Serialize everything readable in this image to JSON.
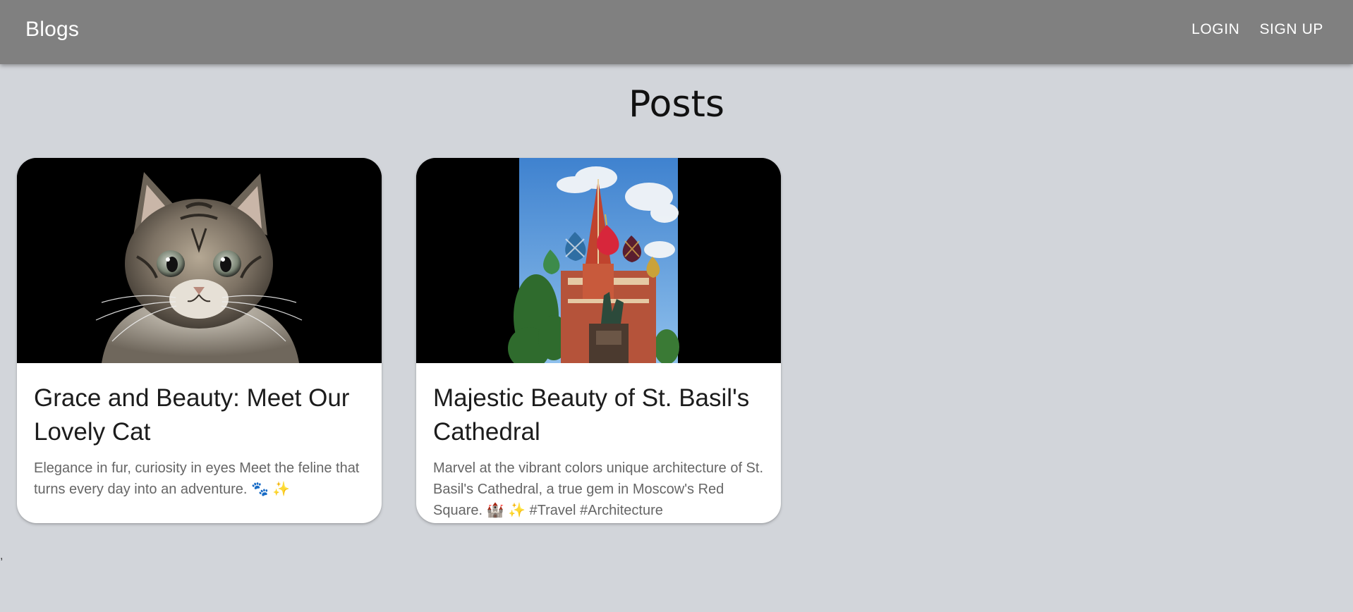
{
  "appbar": {
    "brand": "Blogs",
    "links": [
      "LOGIN",
      "SIGN UP"
    ]
  },
  "page": {
    "title": "Posts",
    "stray_text": ","
  },
  "posts": [
    {
      "title": "Grace and Beauty: Meet Our Lovely Cat",
      "excerpt": "Elegance in fur, curiosity in eyes Meet the feline that turns every day into an adventure. 🐾 ✨",
      "image": "kitten-photo"
    },
    {
      "title": "Majestic Beauty of St. Basil's Cathedral",
      "excerpt": "Marvel at the vibrant colors unique architecture of St. Basil's Cathedral, a true gem in Moscow's Red Square. 🏰 ✨ #Travel #Architecture",
      "image": "cathedral-photo"
    }
  ],
  "colors": {
    "appbar": "#808080",
    "background": "#d2d5da",
    "card": "#ffffff"
  }
}
